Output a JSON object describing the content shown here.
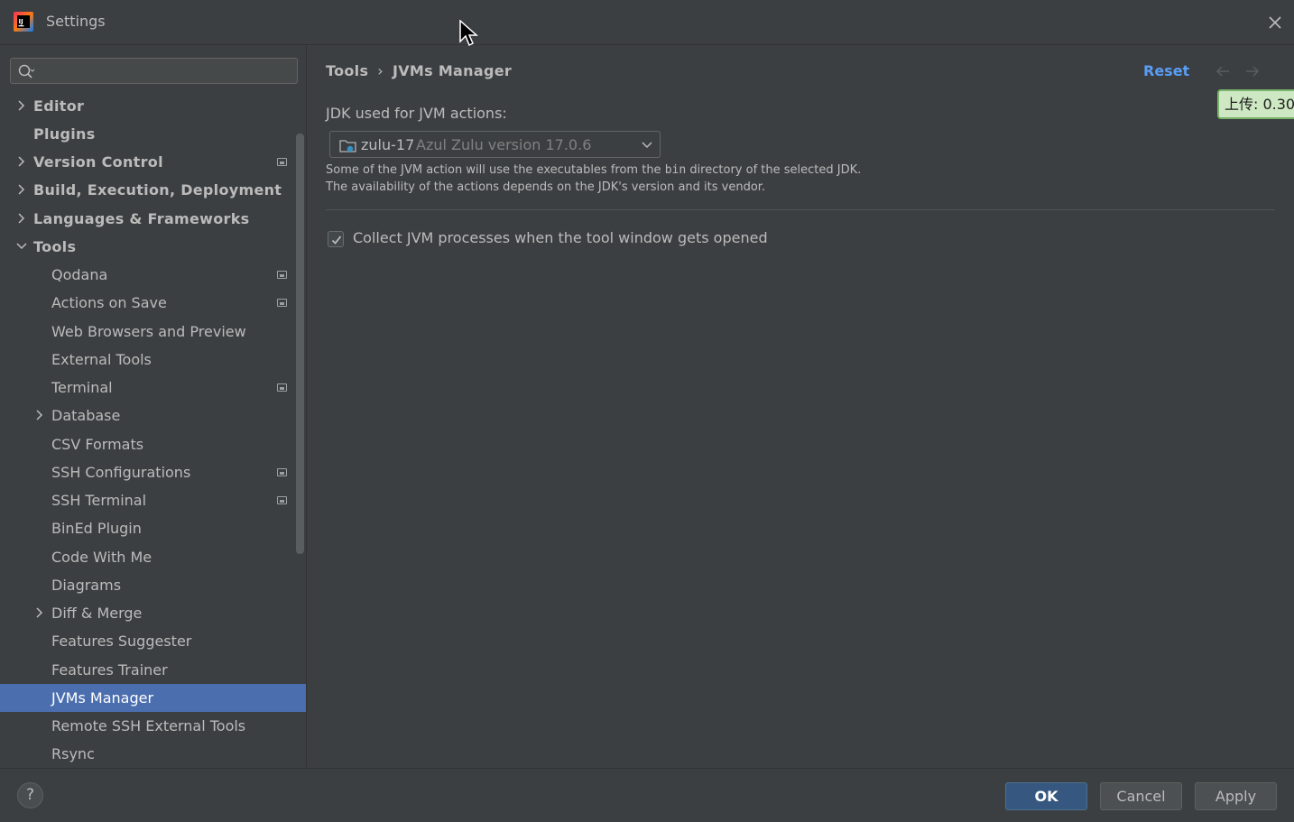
{
  "window": {
    "title": "Settings"
  },
  "sidebar": {
    "search": {
      "value": "",
      "placeholder": ""
    },
    "items": [
      {
        "label": "Editor",
        "level": 0,
        "expandable": true,
        "expanded": false,
        "badge": false
      },
      {
        "label": "Plugins",
        "level": 0,
        "expandable": false,
        "badge": false
      },
      {
        "label": "Version Control",
        "level": 0,
        "expandable": true,
        "expanded": false,
        "badge": true
      },
      {
        "label": "Build, Execution, Deployment",
        "level": 0,
        "expandable": true,
        "expanded": false,
        "badge": false
      },
      {
        "label": "Languages & Frameworks",
        "level": 0,
        "expandable": true,
        "expanded": false,
        "badge": false
      },
      {
        "label": "Tools",
        "level": 0,
        "expandable": true,
        "expanded": true,
        "badge": false
      },
      {
        "label": "Qodana",
        "level": 1,
        "expandable": false,
        "badge": true
      },
      {
        "label": "Actions on Save",
        "level": 1,
        "expandable": false,
        "badge": true
      },
      {
        "label": "Web Browsers and Preview",
        "level": 1,
        "expandable": false,
        "badge": false
      },
      {
        "label": "External Tools",
        "level": 1,
        "expandable": false,
        "badge": false
      },
      {
        "label": "Terminal",
        "level": 1,
        "expandable": false,
        "badge": true
      },
      {
        "label": "Database",
        "level": 1,
        "expandable": true,
        "expanded": false,
        "badge": false
      },
      {
        "label": "CSV Formats",
        "level": 1,
        "expandable": false,
        "badge": false
      },
      {
        "label": "SSH Configurations",
        "level": 1,
        "expandable": false,
        "badge": true
      },
      {
        "label": "SSH Terminal",
        "level": 1,
        "expandable": false,
        "badge": true
      },
      {
        "label": "BinEd Plugin",
        "level": 1,
        "expandable": false,
        "badge": false
      },
      {
        "label": "Code With Me",
        "level": 1,
        "expandable": false,
        "badge": false
      },
      {
        "label": "Diagrams",
        "level": 1,
        "expandable": false,
        "badge": false
      },
      {
        "label": "Diff & Merge",
        "level": 1,
        "expandable": true,
        "expanded": false,
        "badge": false
      },
      {
        "label": "Features Suggester",
        "level": 1,
        "expandable": false,
        "badge": false
      },
      {
        "label": "Features Trainer",
        "level": 1,
        "expandable": false,
        "badge": false
      },
      {
        "label": "JVMs Manager",
        "level": 1,
        "expandable": false,
        "badge": false,
        "selected": true
      },
      {
        "label": "Remote SSH External Tools",
        "level": 1,
        "expandable": false,
        "badge": false
      },
      {
        "label": "Rsync",
        "level": 1,
        "expandable": false,
        "badge": false
      }
    ]
  },
  "content": {
    "breadcrumb": {
      "parent": "Tools",
      "current": "JVMs Manager"
    },
    "reset_label": "Reset",
    "upload_badge": "上传: 0.30",
    "jdk_label": "JDK used for JVM actions:",
    "jdk_select": {
      "name": "zulu-17",
      "version": "Azul Zulu version 17.0.6"
    },
    "hint_line1_before": "Some of the JVM action will use the executables from the ",
    "hint_line1_code": "bin",
    "hint_line1_after": " directory of the selected JDK.",
    "hint_line2": "The availability of the actions depends on the JDK's version and its vendor.",
    "collect_checkbox": {
      "label": "Collect JVM processes when the tool window gets opened",
      "checked": true
    }
  },
  "footer": {
    "help_label": "?",
    "ok_label": "OK",
    "cancel_label": "Cancel",
    "apply_label": "Apply"
  },
  "colors": {
    "background": "#3c3f41",
    "selection": "#4b6eaf",
    "link": "#589df6",
    "ok_button": "#365880"
  }
}
